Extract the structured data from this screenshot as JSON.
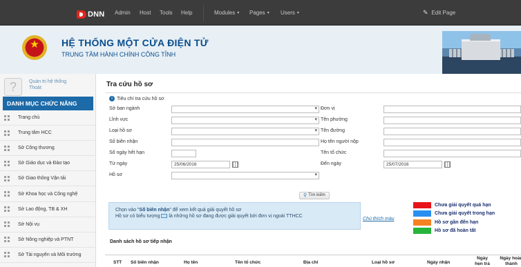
{
  "topbar": {
    "logo_text": "DNN",
    "nav": [
      "Admin",
      "Host",
      "Tools",
      "Help"
    ],
    "dropdowns": [
      "Modules",
      "Pages",
      "Users"
    ],
    "edit_page": "Edit Page"
  },
  "banner": {
    "title": "HỆ THỐNG MỘT CỬA ĐIỆN TỬ",
    "subtitle": "TRUNG TÂM HÀNH CHÍNH CÔNG TỈNH",
    "emblem_star": "★"
  },
  "user": {
    "name": "Quản trị hệ thống",
    "logout": "Thoát"
  },
  "sidebar": {
    "heading": "DANH MỤC CHỨC NĂNG",
    "items": [
      {
        "label": "Trang chủ"
      },
      {
        "label": "Trung tâm HCC"
      },
      {
        "label": "Sở Công thương"
      },
      {
        "label": "Sở Giáo dục và Đào tạo"
      },
      {
        "label": "Sở Giao thông Vận tải"
      },
      {
        "label": "Sở Khoa học và Công nghệ"
      },
      {
        "label": "Sở Lao động, TB & XH"
      },
      {
        "label": "Sở Nội vụ"
      },
      {
        "label": "Sở Nông nghiệp và PTNT"
      },
      {
        "label": "Sở Tài nguyên và Môi trường"
      }
    ]
  },
  "main": {
    "title": "Tra cứu hồ sơ",
    "criteria_label": "Tiêu chí tra cứu hồ sơ",
    "left_labels": [
      "Sở ban ngành",
      "Lĩnh vực",
      "Loại hồ sơ",
      "Số biên nhận",
      "Số ngày hết hạn",
      "Từ ngày",
      "Hồ sơ"
    ],
    "right_labels": [
      "Đơn vị",
      "Tên phường",
      "Tên đường",
      "Họ tên người nộp",
      "Tên tổ chức",
      "Đến ngày"
    ],
    "from_date": "25/06/2016",
    "to_date": "25/07/2016",
    "search_button": "Tìm kiếm",
    "info_line1_pre": "Chọn vào \"",
    "info_line1_bold": "Số biên nhận",
    "info_line1_post": "\" để xem kết quả giải quyết hồ sơ",
    "info_line2_pre": "Hồ sơ có biểu tượng",
    "info_line2_post": "là những hồ sơ đang được giải quyết bởi đơn vị ngoài TTHCC",
    "legend_link": "Chú thích màu",
    "legend": [
      {
        "label": "Chưa giải quyết quá hạn",
        "color": "#e8141b"
      },
      {
        "label": "Chưa giải quyết trong hạn",
        "color": "#2a8ff0"
      },
      {
        "label": "Hồ sơ gần đến hạn",
        "color": "#f58220"
      },
      {
        "label": "Hồ sơ đã hoàn tất",
        "color": "#28b43a"
      }
    ],
    "list_title": "Danh sách hồ sơ tiếp nhận",
    "columns": [
      "STT",
      "Số biên nhận",
      "Họ tên",
      "Tên tổ chức",
      "Địa chỉ",
      "Loại hồ sơ",
      "Ngày nhận",
      "Ngày hẹn trả",
      "Ngày hoàn thành"
    ]
  },
  "colors": {
    "topbar": "#3c3c3c",
    "menu_heading": "#1c6aa8",
    "banner_text": "#0a4d8c"
  }
}
